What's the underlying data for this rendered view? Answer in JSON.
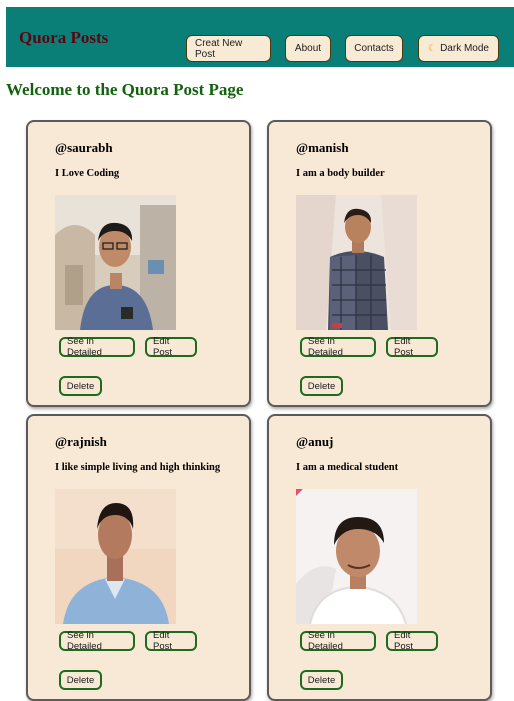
{
  "navbar": {
    "brand": "Quora Posts",
    "buttons": {
      "create": "Creat New Post",
      "about": "About",
      "contacts": "Contacts",
      "dark_mode": "Dark Mode",
      "dark_mode_icon": "moon-icon"
    }
  },
  "page": {
    "welcome": "Welcome to the Quora Post Page"
  },
  "actions": {
    "detail": "See in Detailed",
    "edit": "Edit Post",
    "delete": "Delete"
  },
  "posts": [
    {
      "username": "@saurabh",
      "caption": "I Love Coding"
    },
    {
      "username": "@manish",
      "caption": "I am a body builder"
    },
    {
      "username": "@rajnish",
      "caption": "I like simple living and high thinking"
    },
    {
      "username": "@anuj",
      "caption": "I am a medical student"
    }
  ],
  "colors": {
    "navbar_bg": "#0a7f78",
    "brand": "#5a0610",
    "welcome": "#13620f",
    "card_bg": "#f8e9d6",
    "button_border": "#1e6b1e"
  }
}
